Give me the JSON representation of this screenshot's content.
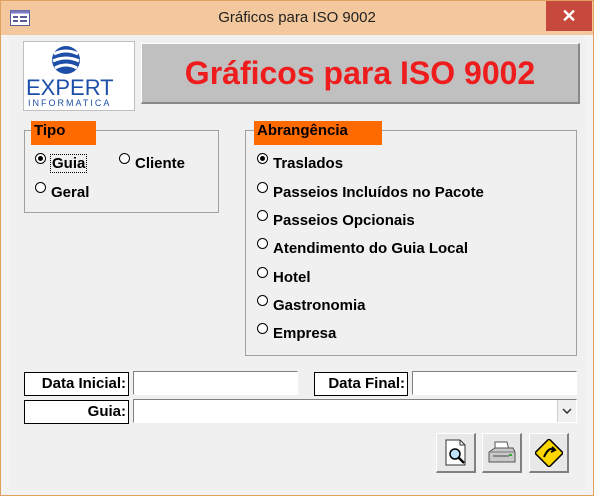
{
  "window": {
    "title": "Gráficos para ISO 9002",
    "close_glyph": "✕"
  },
  "logo": {
    "brand": "EXPERT",
    "sub": "INFORMATICA"
  },
  "header": {
    "title": "Gráficos para ISO 9002"
  },
  "tipo": {
    "label": "Tipo",
    "options": [
      {
        "label": "Guia",
        "checked": true
      },
      {
        "label": "Cliente",
        "checked": false
      },
      {
        "label": "Geral",
        "checked": false
      }
    ]
  },
  "abrangencia": {
    "label": "Abrangência",
    "options": [
      {
        "label": "Traslados",
        "checked": true
      },
      {
        "label": "Passeios Incluídos no Pacote",
        "checked": false
      },
      {
        "label": "Passeios Opcionais",
        "checked": false
      },
      {
        "label": "Atendimento do Guia Local",
        "checked": false
      },
      {
        "label": "Hotel",
        "checked": false
      },
      {
        "label": "Gastronomia",
        "checked": false
      },
      {
        "label": "Empresa",
        "checked": false
      }
    ]
  },
  "fields": {
    "data_inicial_label": "Data Inicial:",
    "data_inicial_value": "",
    "data_final_label": "Data Final:",
    "data_final_value": "",
    "guia_label": "Guia:",
    "guia_value": ""
  },
  "toolbar": {
    "preview_icon": "print-preview-icon",
    "print_icon": "printer-icon",
    "exit_icon": "exit-sign-icon"
  },
  "colors": {
    "accent": "#ff6a00",
    "title_red": "#ee1c1c",
    "titlebar": "#f3c89c",
    "close": "#c7483c"
  }
}
